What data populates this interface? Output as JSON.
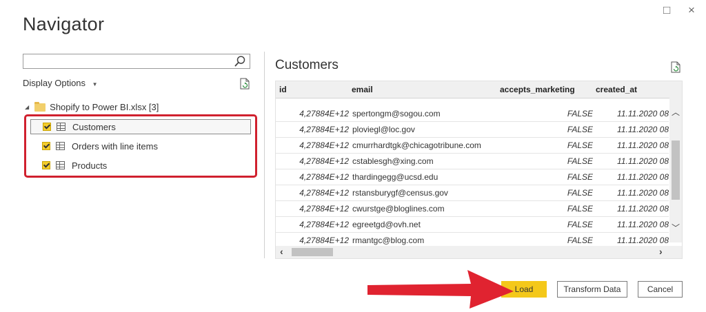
{
  "window": {
    "title": "Navigator",
    "maximize_glyph": "□",
    "close_glyph": "×"
  },
  "left": {
    "search": {
      "value": "",
      "placeholder": ""
    },
    "display_options": "Display Options",
    "tree": {
      "root_label": "Shopify to Power BI.xlsx [3]",
      "items": [
        {
          "label": "Customers",
          "checked": true,
          "selected": true
        },
        {
          "label": "Orders with line items",
          "checked": true,
          "selected": false
        },
        {
          "label": "Products",
          "checked": true,
          "selected": false
        }
      ]
    }
  },
  "preview": {
    "title": "Customers",
    "columns": [
      "id",
      "email",
      "accepts_marketing",
      "created_at"
    ],
    "rows": [
      {
        "id": "4,27884E+12",
        "email": "spertongm@sogou.com",
        "accepts_marketing": "FALSE",
        "created_at": "11.11.2020 08"
      },
      {
        "id": "4,27884E+12",
        "email": "ploviegl@loc.gov",
        "accepts_marketing": "FALSE",
        "created_at": "11.11.2020 08"
      },
      {
        "id": "4,27884E+12",
        "email": "cmurrhardtgk@chicagotribune.com",
        "accepts_marketing": "FALSE",
        "created_at": "11.11.2020 08"
      },
      {
        "id": "4,27884E+12",
        "email": "cstablesgh@xing.com",
        "accepts_marketing": "FALSE",
        "created_at": "11.11.2020 08"
      },
      {
        "id": "4,27884E+12",
        "email": "thardingegg@ucsd.edu",
        "accepts_marketing": "FALSE",
        "created_at": "11.11.2020 08"
      },
      {
        "id": "4,27884E+12",
        "email": "rstansburygf@census.gov",
        "accepts_marketing": "FALSE",
        "created_at": "11.11.2020 08"
      },
      {
        "id": "4,27884E+12",
        "email": "cwurstge@bloglines.com",
        "accepts_marketing": "FALSE",
        "created_at": "11.11.2020 08"
      },
      {
        "id": "4,27884E+12",
        "email": "egreetgd@ovh.net",
        "accepts_marketing": "FALSE",
        "created_at": "11.11.2020 08"
      },
      {
        "id": "4,27884E+12",
        "email": "rmantgc@blog.com",
        "accepts_marketing": "FALSE",
        "created_at": "11.11.2020 08"
      }
    ]
  },
  "buttons": {
    "load": "Load",
    "transform": "Transform Data",
    "cancel": "Cancel"
  },
  "colors": {
    "accent_yellow": "#f4c81a",
    "highlight_red": "#d0202e",
    "arrow_red": "#e02330"
  },
  "icons": {
    "search": "search-icon",
    "refresh": "refresh-icon",
    "folder": "folder-icon",
    "table": "table-icon"
  }
}
